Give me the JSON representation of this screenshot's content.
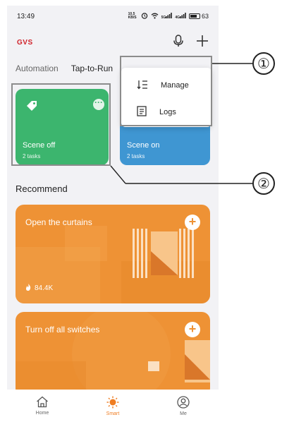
{
  "status_bar": {
    "time": "13:49",
    "net_speed": "10.5 KB/S",
    "signal_1": "5G",
    "signal_2": "4G",
    "battery": "63"
  },
  "header": {
    "logo": "GVS",
    "icons": [
      "microphone-icon",
      "plus-icon"
    ]
  },
  "tabs": [
    {
      "label": "Automation",
      "active": false
    },
    {
      "label": "Tap-to-Run",
      "active": true
    }
  ],
  "more_menu_label": "···",
  "scene_cards": [
    {
      "title": "Scene off",
      "subtitle": "2 tasks",
      "color": "#3cb56e",
      "icon": "tag-icon"
    },
    {
      "title": "Scene on",
      "subtitle": "2 tasks",
      "color": "#3f96d2"
    }
  ],
  "popup_menu": {
    "items": [
      {
        "label": "Manage",
        "icon": "sort-icon"
      },
      {
        "label": "Logs",
        "icon": "document-icon"
      }
    ]
  },
  "recommend": {
    "title": "Recommend",
    "cards": [
      {
        "title": "Open the curtains",
        "count": "84.4K",
        "count_icon": "flame-icon",
        "color": "#ee9235"
      },
      {
        "title": "Turn off all switches",
        "color": "#ee9235"
      }
    ]
  },
  "bottom_nav": [
    {
      "label": "Home",
      "icon": "home-icon",
      "active": false
    },
    {
      "label": "Smart",
      "icon": "sun-icon",
      "active": true
    },
    {
      "label": "Me",
      "icon": "user-icon",
      "active": false
    }
  ],
  "annotations": {
    "callout_1": "①",
    "callout_2": "②"
  }
}
